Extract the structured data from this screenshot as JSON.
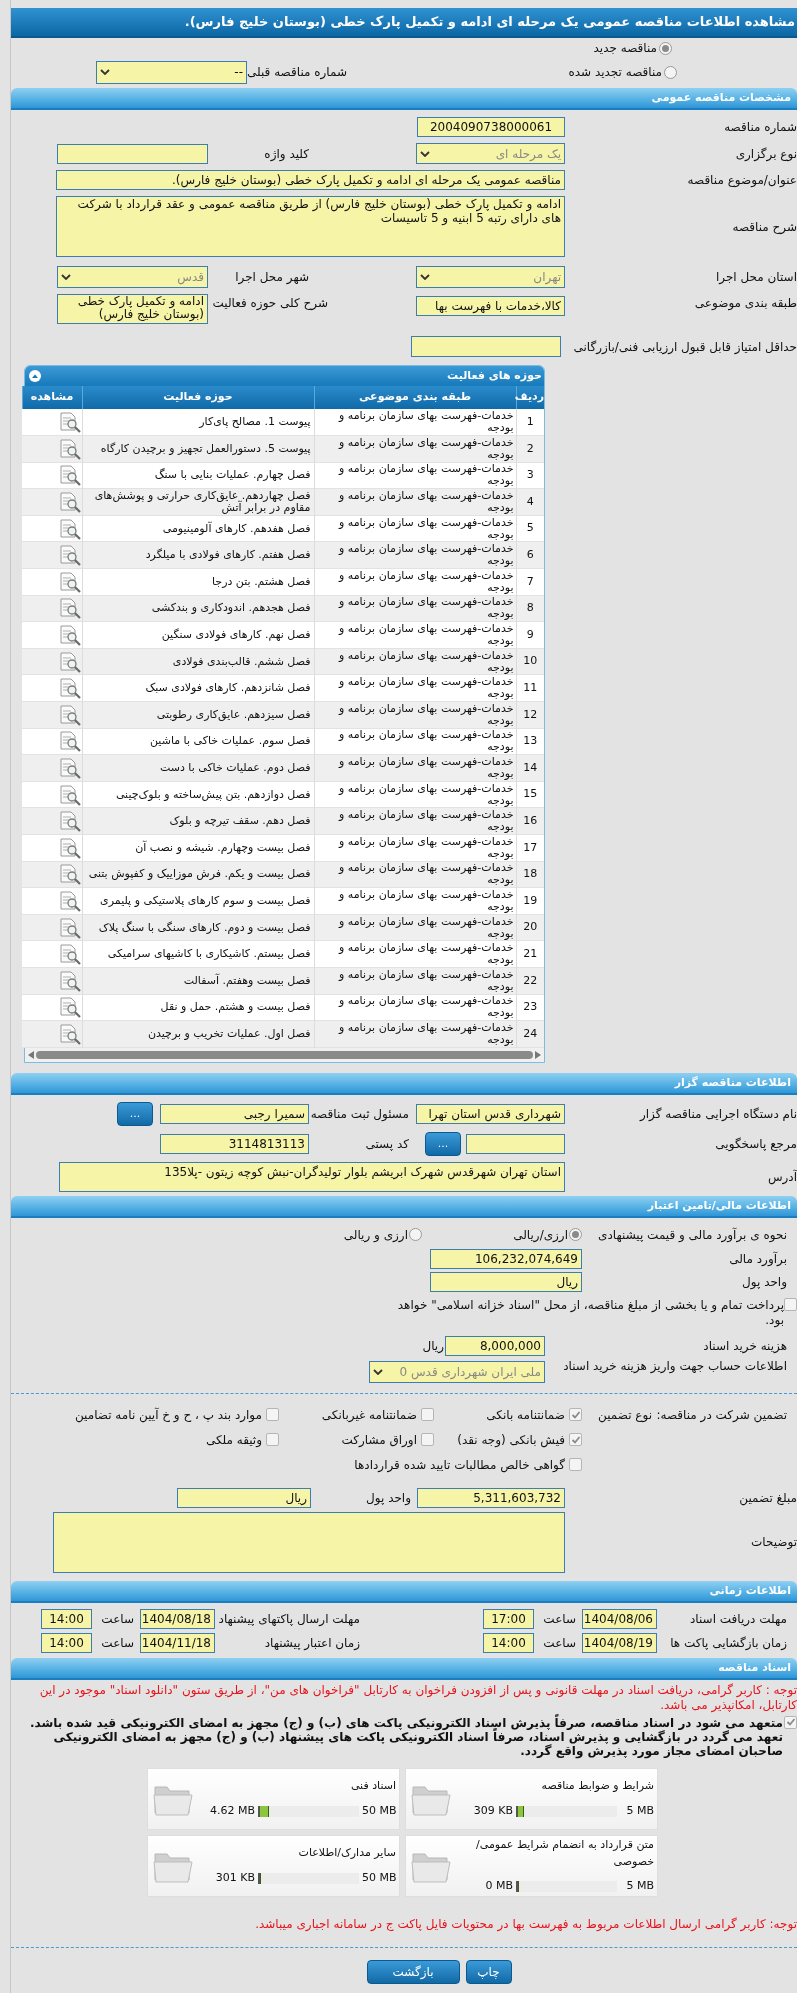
{
  "page_title": "مشاهده اطلاعات مناقصه عمومی یک مرحله ای ادامه و تکمیل پارک خطی (بوستان خلیج فارس).",
  "tender_status": {
    "options": [
      {
        "label": "مناقصه جدید",
        "selected": true
      },
      {
        "label": "مناقصه تجدید شده",
        "selected": false
      }
    ],
    "previous_label": "شماره مناقصه قبلی",
    "previous_value": "--"
  },
  "general": {
    "title": "مشخصات مناقصه عمومی",
    "tender_number_label": "شماره مناقصه",
    "tender_number": "2004090738000061",
    "holding_type_label": "نوع برگزاری",
    "holding_type": "یک مرحله ای",
    "keyword_label": "کلید واژه",
    "subject_label": "عنوان/موضوع مناقصه",
    "subject": "مناقصه عمومی یک مرحله ای ادامه و تکمیل پارک خطی (بوستان خلیج فارس).",
    "description_label": "شرح مناقصه",
    "description": "ادامه و تکمیل پارک خطی (بوستان خلیج فارس) از طریق مناقصه عمومی و عقد قرارداد با شرکت های دارای رتبه 5 ابنیه و 5 تاسیسات",
    "province_label": "استان محل اجرا",
    "province": "تهران",
    "city_label": "شهر محل اجرا",
    "city": "قدس",
    "category_label": "طبقه بندی موضوعی",
    "category": "کالا،خدمات با فهرست بها",
    "activity_summary_label": "شرح کلی حوزه فعالیت",
    "activity_summary": "ادامه و تکمیل پارک خطی (بوستان خلیج فارس)",
    "min_score_label": "حداقل امتیاز قابل قبول ارزیابی فنی/بازرگانی"
  },
  "activities": {
    "title": "حوزه های فعالیت",
    "columns": [
      "ردیف",
      "طبقه بندی موضوعی",
      "حوزه فعالیت",
      "مشاهده"
    ],
    "rows": [
      {
        "index": "1",
        "category": "خدمات-فهرست بهای سازمان برنامه و بودجه",
        "activity": "پیوست 1. مصالح پای‌کار"
      },
      {
        "index": "2",
        "category": "خدمات-فهرست بهای سازمان برنامه و بودجه",
        "activity": "پیوست 5. دستورالعمل تجهیز و برچیدن کارگاه"
      },
      {
        "index": "3",
        "category": "خدمات-فهرست بهای سازمان برنامه و بودجه",
        "activity": "فصل چهارم. عملیات بنایی با سنگ"
      },
      {
        "index": "4",
        "category": "خدمات-فهرست بهای سازمان برنامه و بودجه",
        "activity": "فصل چهاردهم. عایق‌کاری حرارتی و پوشش‌های مقاوم در برابر آتش"
      },
      {
        "index": "5",
        "category": "خدمات-فهرست بهای سازمان برنامه و بودجه",
        "activity": "فصل هفدهم. کارهای آلومینیومی"
      },
      {
        "index": "6",
        "category": "خدمات-فهرست بهای سازمان برنامه و بودجه",
        "activity": "فصل هفتم. کارهای فولادی با میلگرد"
      },
      {
        "index": "7",
        "category": "خدمات-فهرست بهای سازمان برنامه و بودجه",
        "activity": "فصل هشتم. بتن درجا"
      },
      {
        "index": "8",
        "category": "خدمات-فهرست بهای سازمان برنامه و بودجه",
        "activity": "فصل هجدهم. اندودکاری و بندکشی"
      },
      {
        "index": "9",
        "category": "خدمات-فهرست بهای سازمان برنامه و بودجه",
        "activity": "فصل نهم. کارهای فولادی سنگین"
      },
      {
        "index": "10",
        "category": "خدمات-فهرست بهای سازمان برنامه و بودجه",
        "activity": "فصل ششم. قالب‌بندی فولادی"
      },
      {
        "index": "11",
        "category": "خدمات-فهرست بهای سازمان برنامه و بودجه",
        "activity": "فصل شانزدهم. کارهای فولادی سبک"
      },
      {
        "index": "12",
        "category": "خدمات-فهرست بهای سازمان برنامه و بودجه",
        "activity": "فصل سیزدهم. عایق‌کاری رطوبتی"
      },
      {
        "index": "13",
        "category": "خدمات-فهرست بهای سازمان برنامه و بودجه",
        "activity": "فصل سوم. عملیات خاکی با ماشین"
      },
      {
        "index": "14",
        "category": "خدمات-فهرست بهای سازمان برنامه و بودجه",
        "activity": "فصل دوم. عملیات خاکی با دست"
      },
      {
        "index": "15",
        "category": "خدمات-فهرست بهای سازمان برنامه و بودجه",
        "activity": "فصل دوازدهم. بتن پیش‌ساخته و بلوک‌چینی"
      },
      {
        "index": "16",
        "category": "خدمات-فهرست بهای سازمان برنامه و بودجه",
        "activity": "فصل دهم. سقف تیرچه و بلوک"
      },
      {
        "index": "17",
        "category": "خدمات-فهرست بهای سازمان برنامه و بودجه",
        "activity": "فصل بیست وچهارم. شیشه و نصب آن"
      },
      {
        "index": "18",
        "category": "خدمات-فهرست بهای سازمان برنامه و بودجه",
        "activity": "فصل بیست و یکم. فرش موزاییک و کفپوش بتنی"
      },
      {
        "index": "19",
        "category": "خدمات-فهرست بهای سازمان برنامه و بودجه",
        "activity": "فصل بیست و سوم کارهای پلاستیکی و پلیمری"
      },
      {
        "index": "20",
        "category": "خدمات-فهرست بهای سازمان برنامه و بودجه",
        "activity": "فصل بیست و دوم. کارهای سنگی با سنگ پلاک"
      },
      {
        "index": "21",
        "category": "خدمات-فهرست بهای سازمان برنامه و بودجه",
        "activity": "فصل بیستم. کاشیکاری با کاشیهای سرامیکی"
      },
      {
        "index": "22",
        "category": "خدمات-فهرست بهای سازمان برنامه و بودجه",
        "activity": "فصل بیست وهفتم. آسفالت"
      },
      {
        "index": "23",
        "category": "خدمات-فهرست بهای سازمان برنامه و بودجه",
        "activity": "فصل بیست و هشتم. حمل و نقل"
      },
      {
        "index": "24",
        "category": "خدمات-فهرست بهای سازمان برنامه و بودجه",
        "activity": "فصل اول. عملیات تخریب و برچیدن"
      }
    ]
  },
  "organizer": {
    "title": "اطلاعات مناقصه گزار",
    "agency_label": "نام دستگاه اجرایی مناقصه گزار",
    "agency": "شهرداری قدس استان تهرا",
    "registrar_label": "مسئول ثبت مناقصه",
    "registrar": "سمیرا رجبی",
    "registrar_button": "...",
    "reference_label": "مرجع پاسخگویی",
    "reference_button": "...",
    "postal_code_label": "کد پستی",
    "postal_code": "3114813113",
    "address_label": "آدرس",
    "address": "استان تهران شهرقدس شهرک ابریشم بلوار تولیدگران-نبش کوچه زیتون -پلا135"
  },
  "financial": {
    "title": "اطلاعات مالی/تامین اعتبار",
    "estimate_method_label": "نحوه ی برآورد مالی و قیمت پیشنهادی",
    "estimate_methods": [
      {
        "label": "ارزی/ریالی",
        "selected": true
      },
      {
        "label": "ارزی و ریالی",
        "selected": false
      }
    ],
    "estimate_label": "برآورد مالی",
    "estimate": "106,232,074,649",
    "currency_label": "واحد پول",
    "currency": "ریال",
    "treasury": {
      "label": "پرداخت تمام و یا بخشی از مبلغ مناقصه، از محل \"اسناد خزانه اسلامی\" خواهد بود.",
      "checked": false
    },
    "document_fee_label": "هزینه خرید اسناد",
    "document_fee": "8,000,000",
    "document_fee_unit": "ریال",
    "account_label": "اطلاعات حساب جهت واریز هزینه خرید اسناد",
    "account": "ملی ایران شهرداری قدس 0"
  },
  "guarantee": {
    "label": "تضمین شرکت در مناقصه:",
    "type_label": "نوع تضمین",
    "types": [
      {
        "label": "ضمانتنامه بانکی",
        "checked": true
      },
      {
        "label": "ضمانتنامه غیربانکی",
        "checked": false
      },
      {
        "label": "موارد بند پ ، ح و خ آیین نامه تضامین",
        "checked": false
      },
      {
        "label": "فیش بانکی (وجه نقد)",
        "checked": true
      },
      {
        "label": "اوراق مشارکت",
        "checked": false
      },
      {
        "label": "وثیقه ملکی",
        "checked": false
      },
      {
        "label": "گواهی خالص مطالبات تایید شده قراردادها",
        "checked": false
      }
    ],
    "amount_label": "مبلغ تضمین",
    "amount": "5,311,603,732",
    "currency_label": "واحد پول",
    "currency": "ریال",
    "notes_label": "توضیحات"
  },
  "timing": {
    "title": "اطلاعات زمانی",
    "items": [
      {
        "label": "مهلت دریافت اسناد",
        "date": "1404/08/06",
        "time_label": "ساعت",
        "time": "17:00"
      },
      {
        "label": "مهلت ارسال پاکتهای پیشنهاد",
        "date": "1404/08/18",
        "time_label": "ساعت",
        "time": "14:00"
      },
      {
        "label": "زمان بازگشایی پاکت ها",
        "date": "1404/08/19",
        "time_label": "ساعت",
        "time": "14:00"
      },
      {
        "label": "زمان اعتبار پیشنهاد",
        "date": "1404/11/18",
        "time_label": "ساعت",
        "time": "14:00"
      }
    ]
  },
  "documents": {
    "title": "اسناد مناقصه",
    "notice": "توجه : کاربر گرامی، دریافت اسناد در مهلت قانونی و پس از افزودن فراخوان به کارتابل \"فراخوان های من\"، از طریق ستون \"دانلود اسناد\" موجود در این کارتابل، امکانپذیر می باشد.",
    "commitment": {
      "text": "متعهد می شود در اسناد مناقصه، صرفاً پذیرش اسناد الکترونیکی پاکت های (ب) و (ج) مجهز به امضای الکترونیکی قید شده باشد. تعهد می گردد در بازگشایی و پذیرش اسناد، صرفاً اسناد الکترونیکی پاکت های پیشنهاد (ب) و (ج) مجهز به امضای الکترونیکی صاحبان امضای مجاز مورد پذیرش واقع گردد.",
      "checked": true
    },
    "files": [
      {
        "title": "شرایط و ضوابط مناقصه",
        "max": "5 MB",
        "used": "309 KB",
        "level": 0.06
      },
      {
        "title": "اسناد فنی",
        "max": "50 MB",
        "used": "4.62 MB",
        "level": 0.09
      },
      {
        "title": "متن قرارداد به انضمام شرایط عمومی/خصوصی",
        "max": "5 MB",
        "used": "0 MB",
        "level": 0
      },
      {
        "title": "سایر مدارک/اطلاعات",
        "max": "50 MB",
        "used": "301 KB",
        "level": 0.01
      }
    ],
    "footer_notice": "توجه: کاربر گرامی ارسال اطلاعات مربوط به فهرست بها در محتویات فایل پاکت ج در سامانه اجباری میباشد."
  },
  "buttons": [
    "چاپ",
    "بازگشت"
  ]
}
